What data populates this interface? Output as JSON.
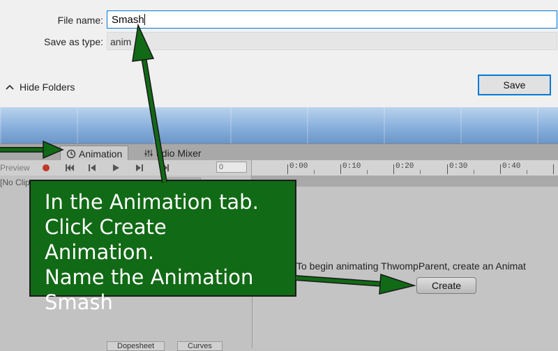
{
  "dialog": {
    "file_name_label": "File name:",
    "file_name_value": "Smash",
    "save_as_type_label": "Save as type:",
    "save_as_type_value": "anim",
    "hide_folders_label": "Hide Folders",
    "save_button": "Save"
  },
  "editor": {
    "tabs": [
      {
        "label": "Animation",
        "icon": "clock-icon"
      },
      {
        "label": "udio Mixer",
        "icon": "mixer-icon"
      }
    ],
    "toolbar": {
      "preview_label": "Preview",
      "frame_value": "0"
    },
    "timeline": {
      "ticks": [
        "0:00",
        "0:10",
        "0:20",
        "0:30",
        "0:40"
      ]
    },
    "clip_selector": "[No Clip",
    "bottom_tabs": [
      "Dopesheet",
      "Curves"
    ],
    "hint_text": "To begin animating ThwompParent, create an Animat",
    "create_button": "Create"
  },
  "callout": {
    "lines": [
      "In the Animation tab.",
      "Click Create Animation.",
      "Name the Animation",
      "Smash"
    ],
    "color": "#116a15"
  }
}
